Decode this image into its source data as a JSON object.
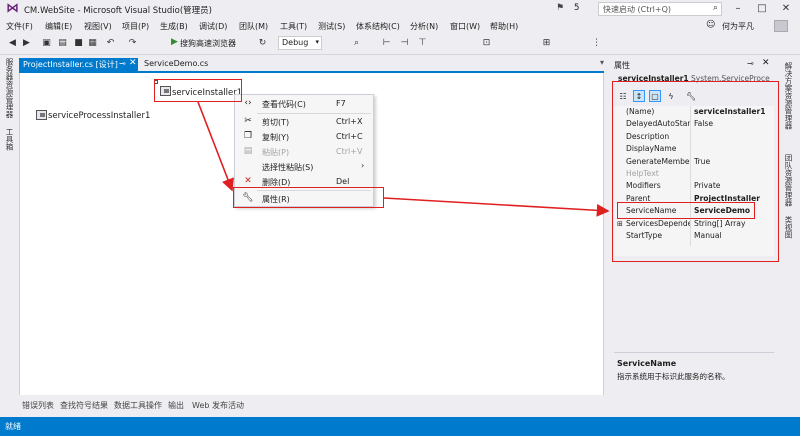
{
  "window": {
    "title": "CM.WebSite - Microsoft Visual Studio(管理员)",
    "notification_count": "5",
    "quick_launch_placeholder": "快速启动 (Ctrl+Q)",
    "user_name": "何为平凡"
  },
  "menubar": [
    "文件(F)",
    "编辑(E)",
    "视图(V)",
    "项目(P)",
    "生成(B)",
    "调试(D)",
    "团队(M)",
    "工具(T)",
    "测试(S)",
    "体系结构(C)",
    "分析(N)",
    "窗口(W)",
    "帮助(H)"
  ],
  "toolbar": {
    "launch_label": "搜狗高速浏览器",
    "config_value": "Debug"
  },
  "left_sidebar": [
    "服务器资源管理器",
    "工具箱"
  ],
  "tabs": {
    "active": "ProjectInstaller.cs [设计]",
    "inactive": "ServiceDemo.cs"
  },
  "designer": {
    "component1": "serviceInstaller1",
    "component2": "serviceProcessInstaller1"
  },
  "context_menu": {
    "view_code": {
      "label": "查看代码(C)",
      "shortcut": "F7"
    },
    "cut": {
      "label": "剪切(T)",
      "shortcut": "Ctrl+X"
    },
    "copy": {
      "label": "复制(Y)",
      "shortcut": "Ctrl+C"
    },
    "paste": {
      "label": "粘贴(P)",
      "shortcut": "Ctrl+V"
    },
    "paste_special": {
      "label": "选择性粘贴(S)"
    },
    "delete": {
      "label": "删除(D)",
      "shortcut": "Del"
    },
    "properties": {
      "label": "属性(R)"
    }
  },
  "properties": {
    "panel_title": "属性",
    "object_name": "serviceInstaller1",
    "object_type": "System.ServiceProcess.ServiceInstaller",
    "rows": [
      {
        "name": "(Name)",
        "value": "serviceInstaller1",
        "bold": true
      },
      {
        "name": "DelayedAutoStart",
        "value": "False"
      },
      {
        "name": "Description",
        "value": ""
      },
      {
        "name": "DisplayName",
        "value": ""
      },
      {
        "name": "GenerateMember",
        "value": "True"
      },
      {
        "name": "HelpText",
        "value": "",
        "grey": true
      },
      {
        "name": "Modifiers",
        "value": "Private"
      },
      {
        "name": "Parent",
        "value": "ProjectInstaller",
        "bold": true
      },
      {
        "name": "ServiceName",
        "value": "ServiceDemo",
        "bold": true
      },
      {
        "name": "ServicesDepende",
        "value": "String[] Array"
      },
      {
        "name": "StartType",
        "value": "Manual"
      }
    ],
    "description_title": "ServiceName",
    "description_text": "指示系统用于标识此服务的名称。"
  },
  "right_sidebar": [
    "解决方案资源管理器",
    "团队资源管理器",
    "类视图"
  ],
  "bottom_tabs": [
    "错误列表",
    "查找符号结果",
    "数据工具操作",
    "输出",
    "Web 发布活动"
  ],
  "status": "就绪",
  "colors": {
    "accent": "#007acc",
    "callout": "#e02020",
    "vs_purple": "#68217a"
  }
}
